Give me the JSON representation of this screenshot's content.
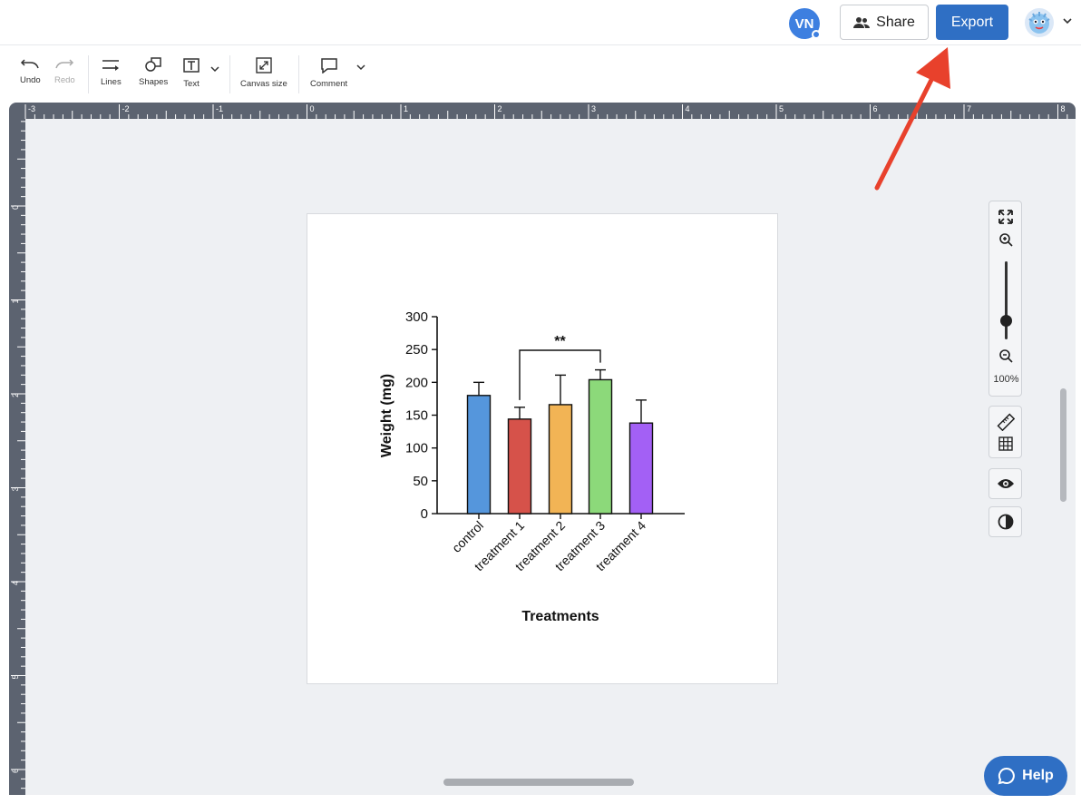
{
  "header": {
    "avatar_initials": "VN",
    "share_label": "Share",
    "export_label": "Export"
  },
  "toolbar": {
    "undo_label": "Undo",
    "redo_label": "Redo",
    "lines_label": "Lines",
    "shapes_label": "Shapes",
    "text_label": "Text",
    "canvas_size_label": "Canvas size",
    "comment_label": "Comment"
  },
  "ruler": {
    "top_labels": [
      "-3",
      "-2",
      "-1",
      "0",
      "1",
      "2",
      "3",
      "4",
      "5",
      "6",
      "7",
      "8"
    ],
    "left_labels": [
      "0",
      "1",
      "2",
      "3",
      "4",
      "5",
      "6"
    ]
  },
  "zoom": {
    "level_label": "100%",
    "level": 100
  },
  "help_label": "Help",
  "colors": {
    "accent": "#2f6fc4",
    "arrow": "#e8412c"
  },
  "chart_data": {
    "type": "bar",
    "categories": [
      "control",
      "treatment 1",
      "treatment 2",
      "treatment 3",
      "treatment 4"
    ],
    "values": [
      180,
      144,
      166,
      204,
      138
    ],
    "errors": [
      20,
      18,
      45,
      15,
      35
    ],
    "colors": [
      "#5596dc",
      "#d6524a",
      "#f2b455",
      "#8cd97a",
      "#a360f5"
    ],
    "ylabel": "Weight (mg)",
    "xlabel": "Treatments",
    "ylim": [
      0,
      300
    ],
    "yticks": [
      0,
      50,
      100,
      150,
      200,
      250,
      300
    ],
    "annotation": {
      "text": "**",
      "from": "treatment 1",
      "to": "treatment 3"
    }
  }
}
